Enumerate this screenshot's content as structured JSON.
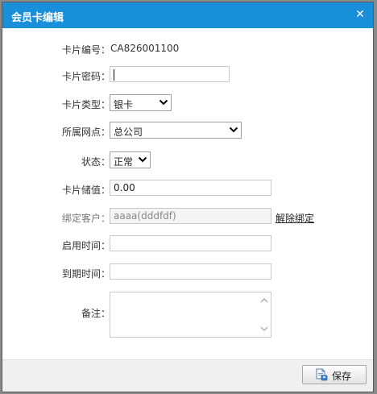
{
  "dialog": {
    "title": "会员卡编辑",
    "close_icon": "close-icon"
  },
  "form": {
    "card_number": {
      "label": "卡片编号：",
      "value": "CA826001100"
    },
    "card_password": {
      "label": "卡片密码：",
      "value": ""
    },
    "card_type": {
      "label": "卡片类型：",
      "value": "银卡"
    },
    "branch": {
      "label": "所属网点：",
      "value": "总公司"
    },
    "status": {
      "label": "状态：",
      "value": "正常"
    },
    "card_balance": {
      "label": "卡片储值：",
      "value": "0.00"
    },
    "bound_customer": {
      "label": "绑定客户：",
      "value": "aaaa(dddfdf)",
      "unbind_label": "解除绑定"
    },
    "start_time": {
      "label": "启用时间：",
      "value": ""
    },
    "expire_time": {
      "label": "到期时间：",
      "value": ""
    },
    "remark": {
      "label": "备注：",
      "value": ""
    }
  },
  "footer": {
    "save_label": "保存",
    "save_icon": "save-document-icon"
  },
  "colors": {
    "titlebar": "#1a8fd9",
    "footer": "#f0f0f0"
  }
}
